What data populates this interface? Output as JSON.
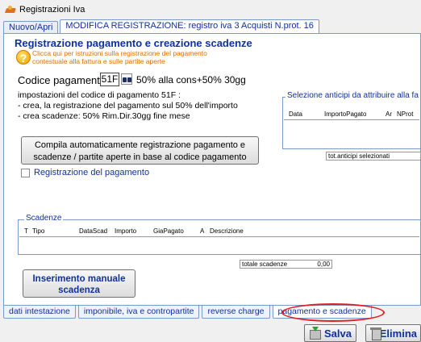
{
  "window": {
    "title": "Registrazioni Iva"
  },
  "top_tabs": [
    {
      "label": "Nuovo/Apri"
    },
    {
      "label": "MODIFICA REGISTRAZIONE:  registro iva 3 Acquisti N.prot. 16"
    }
  ],
  "section": {
    "title": "Registrazione pagamento e creazione scadenze",
    "help_line1": "Clicca qui per istruzioni sulla registrazione del pagamento",
    "help_line2": "contestuale alla fattura e sulle partite aperte"
  },
  "codice": {
    "label": "Codice pagamento",
    "value": "51F",
    "description": "50% alla cons+50% 30gg"
  },
  "impostazioni": {
    "line1": "impostazioni del codice di pagamento 51F :",
    "line2": "- crea, la registrazione del pagamento sul 50% dell'importo",
    "line3": "- crea scadenze: 50% Rim.Dir.30gg fine mese"
  },
  "compila_button": {
    "line1": "Compila automaticamente registrazione pagamento e",
    "line2": "scadenze / partite aperte in base al codice pagamento"
  },
  "registrazione_checkbox": {
    "label": "Registrazione del pagamento",
    "checked": false
  },
  "anticipi": {
    "legend": "Selezione anticipi da attribuire alla fa",
    "columns": [
      "Data",
      "ImportoPagato",
      "Ar",
      "NProt"
    ],
    "total_label": "tot.anticipi selezionati"
  },
  "scadenze": {
    "legend": "Scadenze",
    "columns": [
      "T",
      "Tipo",
      "DataScad",
      "Importo",
      "GiaPagato",
      "A",
      "Descrizione"
    ],
    "total_label": "totale scadenze",
    "total_value": "0,00"
  },
  "inserimento_button": {
    "line1": "Inserimento manuale",
    "line2": "scadenza"
  },
  "bottom_tabs": [
    {
      "label": "dati intestazione"
    },
    {
      "label": "imponibile, iva e contropartite"
    },
    {
      "label": "reverse charge"
    },
    {
      "label": "pagamento e scadenze"
    }
  ],
  "footer": {
    "salva": "Salva",
    "elimina": "Elimina"
  },
  "colors": {
    "accent": "#1030a0",
    "help_text": "#e07000",
    "highlight": "#e02020"
  }
}
